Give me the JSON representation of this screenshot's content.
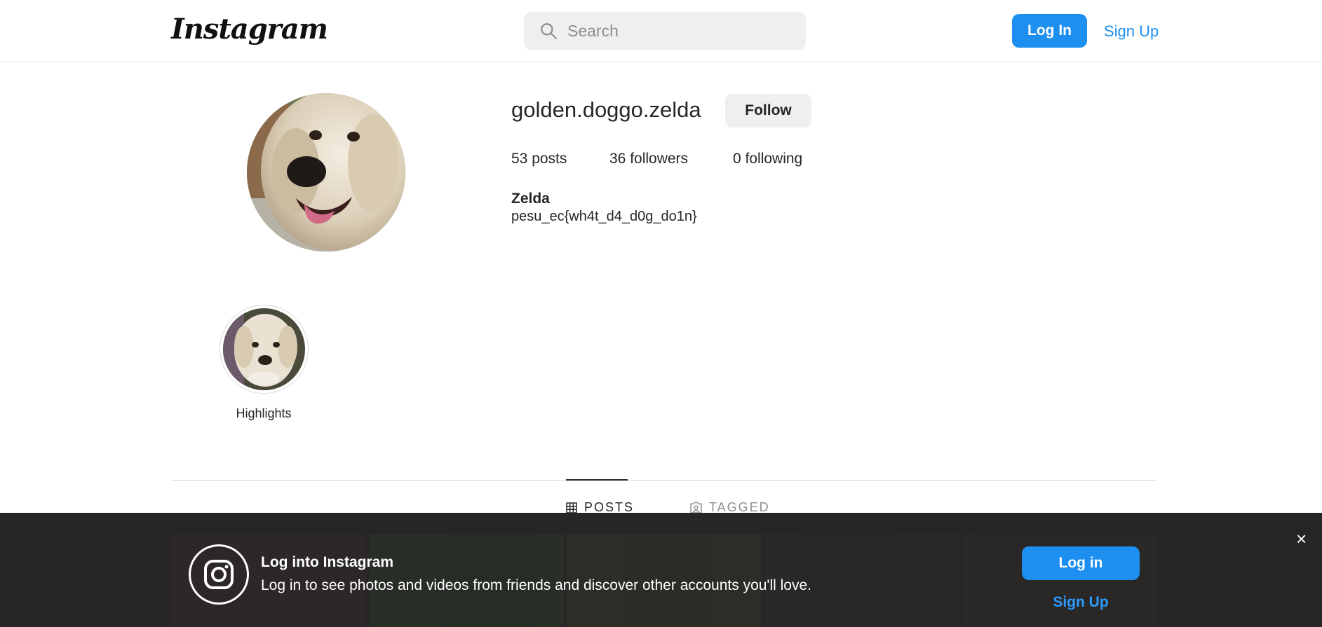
{
  "header": {
    "logo_text": "Instagram",
    "search_placeholder": "Search",
    "login_label": "Log In",
    "signup_label": "Sign Up"
  },
  "profile": {
    "username": "golden.doggo.zelda",
    "follow_label": "Follow",
    "posts": "53 posts",
    "followers": "36 followers",
    "following": "0 following",
    "full_name": "Zelda",
    "bio": "pesu_ec{wh4t_d4_d0g_do1n}"
  },
  "highlights": [
    {
      "label": "Highlights"
    }
  ],
  "tabs": [
    {
      "label": "POSTS",
      "icon": "grid-icon",
      "active": true
    },
    {
      "label": "TAGGED",
      "icon": "tag-user-icon",
      "active": false
    }
  ],
  "login_banner": {
    "title": "Log into Instagram",
    "subtitle": "Log in to see photos and videos from friends and discover other accounts you'll love.",
    "login_label": "Log in",
    "signup_label": "Sign Up",
    "close_glyph": "×"
  },
  "colors": {
    "accent": "#1d8ff0",
    "banner_bg": "#262626",
    "button_gray": "#efefef"
  }
}
